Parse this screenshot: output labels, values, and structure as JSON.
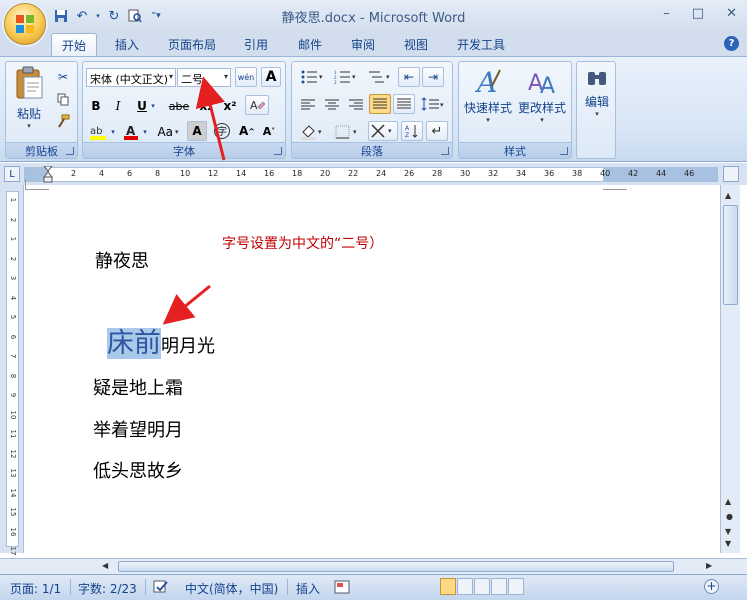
{
  "window": {
    "title": "静夜思.docx - Microsoft Word",
    "minimize": "–",
    "restore": "□",
    "close": "✕"
  },
  "tabs": [
    "开始",
    "插入",
    "页面布局",
    "引用",
    "邮件",
    "审阅",
    "视图",
    "开发工具"
  ],
  "active_tab": "开始",
  "ribbon": {
    "clipboard": {
      "label": "剪贴板",
      "paste": "粘贴"
    },
    "font": {
      "label": "字体",
      "font_name": "宋体 (中文正文)",
      "font_size": "二号",
      "bold": "B",
      "italic": "I",
      "underline": "U",
      "strike": "abe",
      "sub": "x₂",
      "sup": "x²",
      "case": "Aa",
      "char_border": "A",
      "grow": "A^",
      "shrink": "A˅",
      "clear": "A",
      "phonetic": "wén"
    },
    "paragraph": {
      "label": "段落"
    },
    "styles": {
      "label": "样式",
      "quick": "快速样式",
      "change": "更改样式"
    },
    "editing": {
      "label": "编辑"
    }
  },
  "ruler": {
    "corner": "L",
    "ticks": [
      "2",
      "4",
      "6",
      "8",
      "10",
      "12",
      "14",
      "16",
      "18",
      "20",
      "22",
      "24",
      "26",
      "28",
      "30",
      "32",
      "34",
      "36",
      "38",
      "40",
      "42",
      "44",
      "46"
    ],
    "vticks": [
      "1",
      "2",
      "1",
      "2",
      "3",
      "4",
      "5",
      "6",
      "7",
      "8",
      "9",
      "10",
      "11",
      "12",
      "13",
      "14",
      "15",
      "16",
      "17"
    ]
  },
  "annotation": {
    "text": "字号设置为中文的“二号）"
  },
  "document": {
    "title": "静夜思",
    "line1_selected": "床前",
    "line1_rest": "明月光",
    "line2": "疑是地上霜",
    "line3": "举着望明月",
    "line4": "低头思故乡"
  },
  "status": {
    "page": "页面: 1/1",
    "words": "字数: 2/23",
    "language": "中文(简体，中国)",
    "insert": "插入"
  },
  "colors": {
    "accent": "#15428b",
    "annotation": "#c00000",
    "selection": "#a9c8ea"
  }
}
